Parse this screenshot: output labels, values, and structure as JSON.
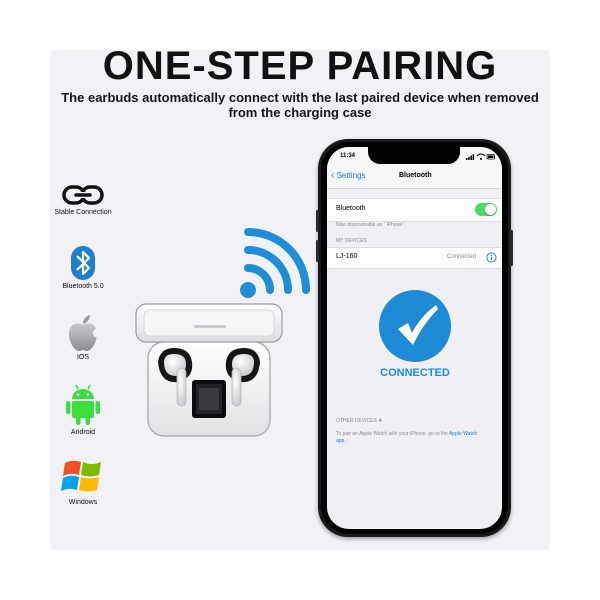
{
  "header": {
    "title": "ONE-STEP PAIRING",
    "subtitle": "The earbuds automatically connect with the last paired device when removed from the charging case"
  },
  "features": [
    {
      "label": "Stable Connection",
      "icon": "link-icon"
    },
    {
      "label": "Bluetooth 5.0",
      "icon": "bluetooth-icon"
    },
    {
      "label": "IOS",
      "icon": "apple-icon"
    },
    {
      "label": "Android",
      "icon": "android-icon"
    },
    {
      "label": "Windows",
      "icon": "windows-icon"
    }
  ],
  "phone": {
    "time": "11:34",
    "back_label": "Settings",
    "screen_title": "Bluetooth",
    "bluetooth_label": "Bluetooth",
    "bluetooth_on": true,
    "discoverable_note": "Now discoverable as “ iPhone”.",
    "my_devices_header": "MY DEVICES",
    "device_name": "LJ-160",
    "device_status": "Connected",
    "connected_banner": "CONNECTED",
    "other_devices_header": "OTHER DEVICES",
    "watch_note_prefix": "To pair an Apple Watch with your iPhone, go to the",
    "watch_link": "Apple Watch app."
  },
  "colors": {
    "accent_blue": "#1e8bd6",
    "toggle_green": "#4cd964",
    "wifi_blue": "#1e8ed8",
    "panel_bg": "#f1f1f6"
  }
}
